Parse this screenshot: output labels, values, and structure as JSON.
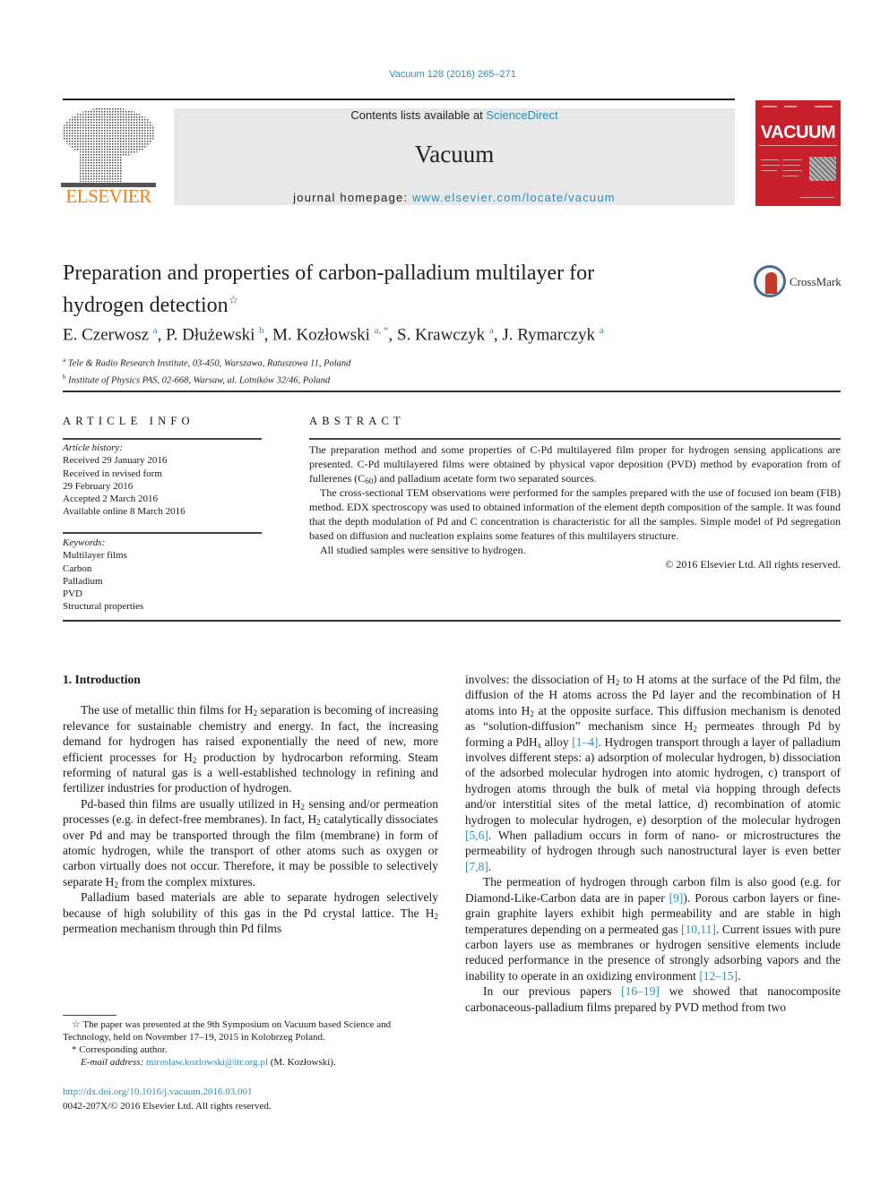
{
  "header": {
    "journal_ref": "Vacuum 128 (2016) 265–271",
    "contents_prefix": "Contents lists available at ",
    "contents_link": "ScienceDirect",
    "journal_name": "Vacuum",
    "homepage_prefix": "journal homepage: ",
    "homepage_link": "www.elsevier.com/locate/vacuum",
    "publisher_logo_text": "ELSEVIER",
    "cover_title": "VACUUM",
    "crossmark_label": "CrossMark"
  },
  "colors": {
    "link": "#2a8fbd",
    "elsevier_orange": "#f07d1a",
    "cover_red": "#c8202a",
    "masthead_gray": "#e8e8e8"
  },
  "article": {
    "title_line1": "Preparation and properties of carbon-palladium multilayer for",
    "title_line2": "hydrogen detection",
    "title_note_mark": "☆",
    "authors": [
      {
        "name": "E. Czerwosz",
        "aff": "a"
      },
      {
        "name": "P. Dłużewski",
        "aff": "b"
      },
      {
        "name": "M. Kozłowski",
        "aff": "a, *"
      },
      {
        "name": "S. Krawczyk",
        "aff": "a"
      },
      {
        "name": "J. Rymarczyk",
        "aff": "a"
      }
    ],
    "affiliations": [
      {
        "mark": "a",
        "text": "Tele & Radio Research Institute, 03-450, Warszawa, Ratuszowa 11, Poland"
      },
      {
        "mark": "b",
        "text": "Institute of Physics PAS, 02-668, Warsaw, al. Lotników 32/46, Poland"
      }
    ]
  },
  "article_info": {
    "heading": "ARTICLE INFO",
    "history_label": "Article history:",
    "history": [
      "Received 29 January 2016",
      "Received in revised form",
      "29 February 2016",
      "Accepted 2 March 2016",
      "Available online 8 March 2016"
    ],
    "keywords_label": "Keywords:",
    "keywords": [
      "Multilayer films",
      "Carbon",
      "Palladium",
      "PVD",
      "Structural properties"
    ]
  },
  "abstract": {
    "heading": "ABSTRACT",
    "p1_a": "The preparation method and some properties of C-Pd multilayered film proper for hydrogen sensing applications are presented. C-Pd multilayered films were obtained by physical vapor deposition (PVD) method by evaporation from of fullerenes (C",
    "p1_sub": "60",
    "p1_b": ") and palladium acetate form two separated sources.",
    "p2": "The cross-sectional TEM observations were performed for the samples prepared with the use of focused ion beam (FIB) method. EDX spectroscopy was used to obtained information of the element depth composition of the sample. It was found that the depth modulation of Pd and C concentration is characteristic for all the samples. Simple model of Pd segregation based on diffusion and nucleation explains some features of this multilayers structure.",
    "p3": "All studied samples were sensitive to hydrogen.",
    "copyright": "© 2016 Elsevier Ltd. All rights reserved."
  },
  "body": {
    "section_heading": "1.  Introduction",
    "left": {
      "p1_a": "The use of metallic thin films for H",
      "p1_b": " separation is becoming of increasing relevance for sustainable chemistry and energy. In fact, the increasing demand for hydrogen has raised exponentially the need of new, more efficient processes for H",
      "p1_c": " production by hydrocarbon reforming. Steam reforming of natural gas is a well-established technology in refining and fertilizer industries for production of hydrogen.",
      "p2_a": "Pd-based thin films are usually utilized in H",
      "p2_b": " sensing and/or permeation processes (e.g. in defect-free membranes). In fact, H",
      "p2_c": " catalytically dissociates over Pd and may be transported through the film (membrane) in form of atomic hydrogen, while the transport of other atoms such as oxygen or carbon virtually does not occur. Therefore, it may be possible to selectively separate H",
      "p2_d": " from the complex mixtures.",
      "p3_a": "Palladium based materials are able to separate hydrogen selectively because of high solubility of this gas in the Pd crystal lattice. The H",
      "p3_b": " permeation mechanism through thin Pd films"
    },
    "right": {
      "p1_a": "involves: the dissociation of H",
      "p1_b": " to H atoms at the surface of the Pd film, the diffusion of the H atoms across the Pd layer and the recombination of H atoms into H",
      "p1_c": " at the opposite surface. This diffusion mechanism is denoted as “solution-diffusion” mechanism since H",
      "p1_d": " permeates through Pd by forming a PdH",
      "p1_e": " alloy ",
      "cite1": "[1–4]",
      "p1_f": ". Hydrogen transport through a layer of palladium involves different steps: a) adsorption of molecular hydrogen, b) dissociation of the adsorbed molecular hydrogen into atomic hydrogen, c) transport of hydrogen atoms through the bulk of metal via hopping through defects and/or interstitial sites of the metal lattice, d) recombination of atomic hydrogen to molecular hydrogen, e) desorption of the molecular hydrogen ",
      "cite2": "[5,6]",
      "p1_g": ". When palladium occurs in form of nano- or microstructures the permeability of hydrogen through such nanostructural layer is even better ",
      "cite3": "[7,8]",
      "p1_h": ".",
      "p2_a": "The permeation of hydrogen through carbon film is also good (e.g. for Diamond-Like-Carbon data are in paper ",
      "cite4": "[9]",
      "p2_b": "). Porous carbon layers or fine-grain graphite layers exhibit high permeability and are stable in high temperatures depending on a permeated gas ",
      "cite5": "[10,11]",
      "p2_c": ". Current issues with pure carbon layers use as membranes or hydrogen sensitive elements include reduced performance in the presence of strongly adsorbing vapors and the inability to operate in an oxidizing environment ",
      "cite6": "[12–15]",
      "p2_d": ".",
      "p3_a": "In our previous papers ",
      "cite7": "[16–19]",
      "p3_b": " we showed that nanocomposite carbonaceous-palladium films prepared by PVD method from two"
    },
    "sub_2": "2",
    "sub_x": "x"
  },
  "footnotes": {
    "note1_mark": "☆",
    "note1": " The paper was presented at the 9th Symposium on Vacuum based Science and Technology, held on November 17–19, 2015 in Kolobrzeg Poland.",
    "note2_mark": "*",
    "note2": " Corresponding author.",
    "email_label": "E-mail address: ",
    "email": "miroslaw.kozlowski@itr.org.pl",
    "email_suffix": " (M. Kozłowski).",
    "doi": "http://dx.doi.org/10.1016/j.vacuum.2016.03.001",
    "issn_copyright": "0042-207X/© 2016 Elsevier Ltd. All rights reserved."
  }
}
